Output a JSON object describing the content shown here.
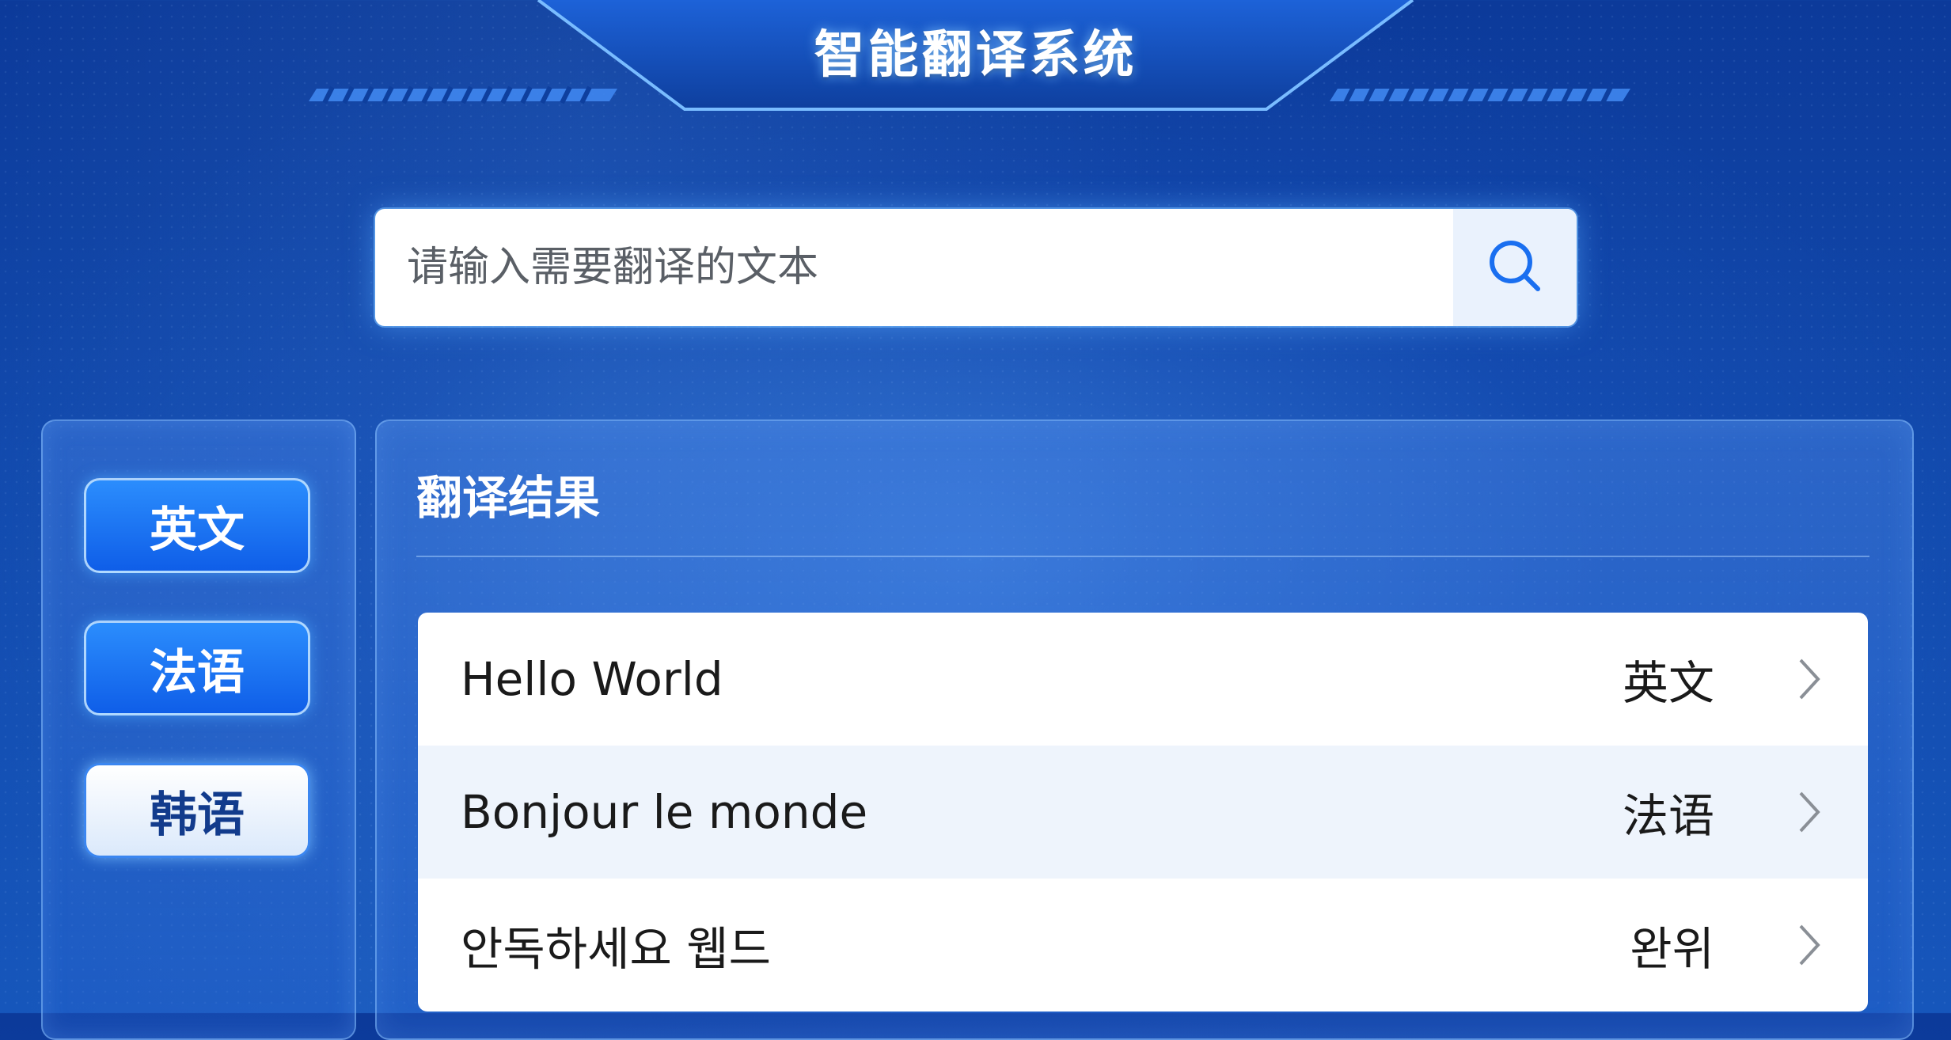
{
  "header": {
    "title": "智能翻译系统"
  },
  "search": {
    "placeholder": "请输入需要翻译的文本",
    "icon": "search-icon"
  },
  "sidebar": {
    "languages": [
      {
        "label": "英文",
        "state": "default"
      },
      {
        "label": "法语",
        "state": "default"
      },
      {
        "label": "韩语",
        "state": "selected"
      }
    ]
  },
  "results": {
    "title": "翻译结果",
    "items": [
      {
        "text": "Hello World",
        "lang": "英文"
      },
      {
        "text": "Bonjour le monde",
        "lang": "法语"
      },
      {
        "text": "안독하세요 웹드",
        "lang": "완위"
      }
    ]
  },
  "colors": {
    "accent": "#1a6ff0",
    "background": "#124aad",
    "selected_text": "#123b8c"
  }
}
